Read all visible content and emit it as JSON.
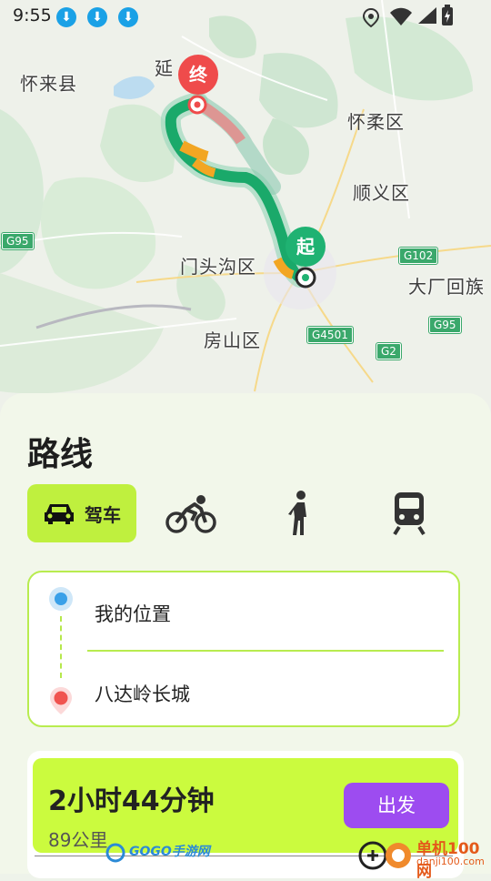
{
  "status": {
    "time": "9:55",
    "download_icons": [
      "download-icon",
      "download-icon",
      "download-icon"
    ],
    "right_icons": [
      "location-icon",
      "wifi-icon",
      "battery-icon"
    ]
  },
  "map": {
    "labels": {
      "huailai": "怀来县",
      "yan": "延",
      "huairou": "怀柔区",
      "shunyi": "顺义区",
      "mentougou": "门头沟区",
      "dachang": "大厂回族",
      "fangshan": "房山区"
    },
    "shields": {
      "g95_left": "G95",
      "g102": "G102",
      "g95_right": "G95",
      "g4501": "G4501",
      "g2": "G2"
    },
    "end_marker": "终",
    "start_marker": "起",
    "colors": {
      "route": "#1aa96a",
      "congestion": "#e48a8a",
      "slow": "#f2a623",
      "end_marker": "#ef4b4b",
      "start_marker": "#1fb272"
    }
  },
  "sheet": {
    "title": "路线",
    "modes": {
      "drive": "驾车",
      "drive_icon": "car-icon",
      "bike_icon": "bicycle-icon",
      "walk_icon": "walking-icon",
      "transit_icon": "train-icon"
    },
    "from": "我的位置",
    "to": "八达岭长城",
    "result": {
      "duration": "2小时44分钟",
      "distance": "89公里",
      "go_label": "出发"
    },
    "accent": "#bff03e",
    "button_color": "#9d4cf0"
  },
  "watermark": {
    "left": "GOGO手游网",
    "right": "单机100网",
    "right_sub": "danji100.com"
  }
}
